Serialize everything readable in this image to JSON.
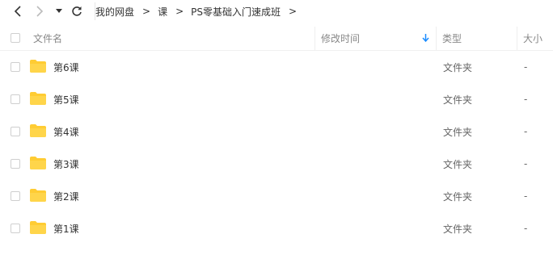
{
  "breadcrumb": [
    "我的网盘",
    "课",
    "PS零基础入门速成班"
  ],
  "breadcrumb_separator": ">",
  "columns": {
    "name": "文件名",
    "modified": "修改时间",
    "type": "类型",
    "size": "大小"
  },
  "colors": {
    "folder": "#ffcc33",
    "sort_arrow": "#1a8cff"
  },
  "rows": [
    {
      "name": "第6课",
      "modified": "",
      "type": "文件夹",
      "size": "-"
    },
    {
      "name": "第5课",
      "modified": "",
      "type": "文件夹",
      "size": "-"
    },
    {
      "name": "第4课",
      "modified": "",
      "type": "文件夹",
      "size": "-"
    },
    {
      "name": "第3课",
      "modified": "",
      "type": "文件夹",
      "size": "-"
    },
    {
      "name": "第2课",
      "modified": "",
      "type": "文件夹",
      "size": "-"
    },
    {
      "name": "第1课",
      "modified": "",
      "type": "文件夹",
      "size": "-"
    }
  ]
}
